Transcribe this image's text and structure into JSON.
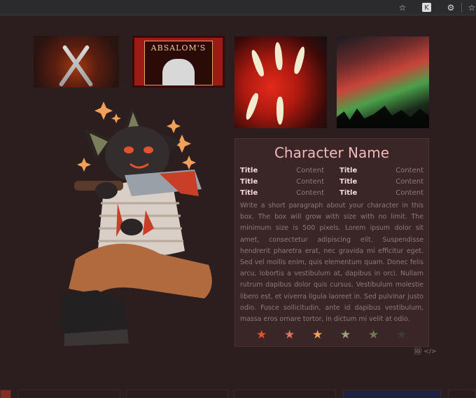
{
  "browser": {
    "icons": [
      "star-add-icon",
      "extension-icon",
      "puzzle-icon",
      "favorites-icon"
    ]
  },
  "thumbnails": {
    "t2_text": "ABSALOM'S"
  },
  "info": {
    "title": "Character Name",
    "stats": [
      {
        "key": "Title",
        "value": "Content"
      },
      {
        "key": "Title",
        "value": "Content"
      },
      {
        "key": "Title",
        "value": "Content"
      },
      {
        "key": "Title",
        "value": "Content"
      },
      {
        "key": "Title",
        "value": "Content"
      },
      {
        "key": "Title",
        "value": "Content"
      }
    ],
    "paragraph": "Write a short paragraph about your character in this box. The box will grow with size with no limit. The minimum size is 500 pixels. Lorem ipsum dolor sit amet, consectetur adipiscing elit. Suspendisse hendrerit pharetra erat, nec gravida mi efficitur eget. Sed vel mollis enim, quis elementum quam. Donec felis arcu, lobortis a vestibulum at, dapibus in orci. Nullam rutrum dapibus dolor quis cursus. Vestibulum molestie libero est, et viverra ligula laoreet in. Sed pulvinar justo odio. Fusce sollicitudin, ante id dapibus vestibulum, massa eros ornare tortor, in dictum mi velit at odio.",
    "stars": [
      {
        "color": "#e4512f"
      },
      {
        "color": "#d97562"
      },
      {
        "color": "#f2a15a"
      },
      {
        "color": "#9aa47c"
      },
      {
        "color": "#6f7a52"
      },
      {
        "color": "#3f3b2e"
      }
    ],
    "credit": "🖼 </>"
  },
  "colors": {
    "background": "#2c1e1f",
    "box": "#3b2627",
    "name": "#f3b9b9",
    "stat_key": "#f6d8e3",
    "muted": "#8c7a7a"
  }
}
